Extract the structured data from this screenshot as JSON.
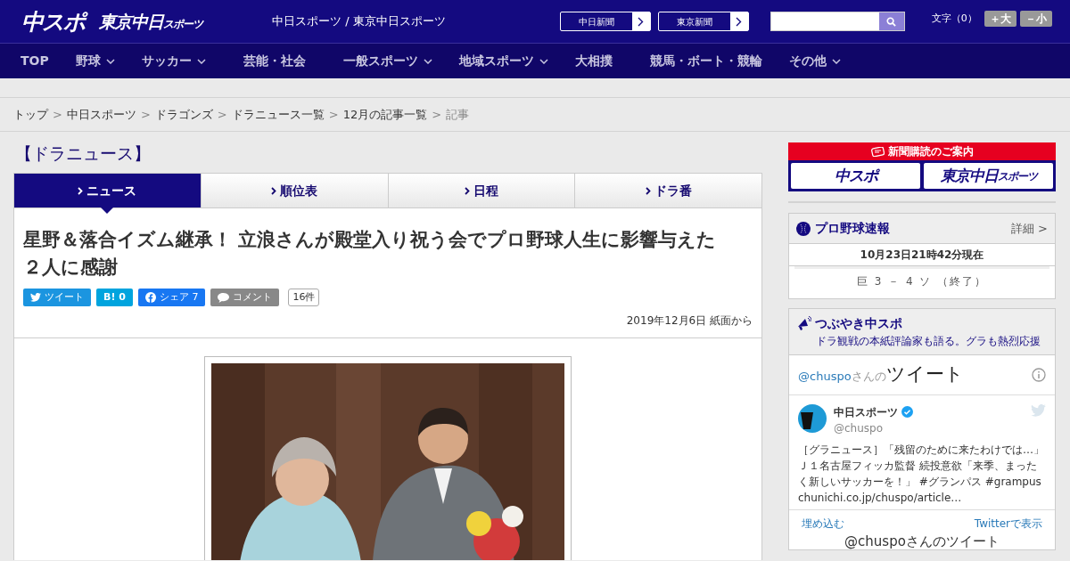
{
  "header": {
    "logo_main": "中スポ",
    "logo_tokyo": "東京中日",
    "logo_tokyo_small": "スポーツ",
    "site_title": "中日スポーツ / 東京中日スポーツ",
    "paper_links": [
      "中日新聞",
      "東京新聞"
    ],
    "font_size": {
      "label": "文字（0）",
      "buttons": [
        "＋大",
        "－小"
      ]
    }
  },
  "nav": [
    {
      "label": "TOP",
      "dropdown": false
    },
    {
      "label": "野球",
      "dropdown": true
    },
    {
      "label": "サッカー",
      "dropdown": true
    },
    {
      "label": "芸能・社会",
      "dropdown": false
    },
    {
      "label": "一般スポーツ",
      "dropdown": true
    },
    {
      "label": "地域スポーツ",
      "dropdown": true
    },
    {
      "label": "大相撲",
      "dropdown": false
    },
    {
      "label": "競馬・ボート・競輪",
      "dropdown": false
    },
    {
      "label": "その他",
      "dropdown": true
    }
  ],
  "breadcrumb": [
    {
      "label": "トップ",
      "link": true
    },
    {
      "separator": ">",
      "label": "中日スポーツ",
      "link": true
    },
    {
      "separator": ">",
      "label": "ドラゴンズ",
      "link": true
    },
    {
      "separator": ">",
      "label": "ドラニュース一覧",
      "link": true
    },
    {
      "separator": ">",
      "label": "12月の記事一覧",
      "link": true
    },
    {
      "separator": ">",
      "label": "記事",
      "link": false
    }
  ],
  "section_title": "【ドラニュース】",
  "tabs": [
    {
      "label": "ニュース",
      "selected": true
    },
    {
      "label": "順位表",
      "selected": false
    },
    {
      "label": "日程",
      "selected": false
    },
    {
      "label": "ドラ番",
      "selected": false
    }
  ],
  "article": {
    "headline": "星野＆落合イズム継承！ 立浪さんが殿堂入り祝う会でプロ野球人生に影響与えた２人に感謝",
    "share": [
      {
        "kind": "twitter",
        "label": "ツイート"
      },
      {
        "kind": "hatena",
        "label": "B! 0"
      },
      {
        "kind": "facebook",
        "label": "シェア 7"
      },
      {
        "kind": "comment",
        "label": "コメント"
      }
    ],
    "comment_count": "16件",
    "date": "2019年12月6日 紙面から"
  },
  "sidebar": {
    "subscribe": {
      "title": "新聞購読のご案内",
      "logos": [
        "中スポ",
        "東京中日"
      ],
      "logo_small": "スポーツ"
    },
    "score": {
      "title": "プロ野球速報",
      "detail": "詳細 >",
      "updated": "10月23日21時42分現在",
      "games": [
        "巨 3 － 4 ソ （終了）"
      ]
    },
    "tweets": {
      "title": "つぶやき中スポ",
      "subtitle": "ドラ観戦の本紙評論家も語る。グラも熱烈応援",
      "widget_handle": "@chuspo",
      "widget_suffix": "さんの",
      "widget_title": "ツイート",
      "tweet": {
        "name": "中日スポーツ",
        "verified": true,
        "handle": "@chuspo",
        "text": "［グラニュース］「残留のために来たわけでは…」Ｊ１名古屋フィッカ監督 続投意欲「来季、まったく新しいサッカーを！」",
        "hashtags": [
          "#グランパス",
          "#grampus"
        ],
        "link": "chunichi.co.jp/chuspo/article…"
      },
      "embed": "埋め込む",
      "view": "Twitterで表示",
      "footer": "@chuspoさんのツイート"
    }
  }
}
